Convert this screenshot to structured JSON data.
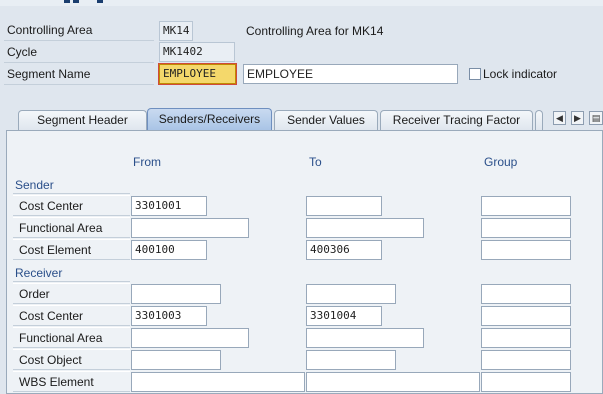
{
  "header": {
    "controlling_area": {
      "label": "Controlling Area",
      "value": "MK14",
      "description": "Controlling Area for MK14"
    },
    "cycle": {
      "label": "Cycle",
      "value": "MK1402"
    },
    "segment_name": {
      "label": "Segment Name",
      "value": "EMPLOYEE",
      "description": "EMPLOYEE"
    },
    "lock_indicator": {
      "label": "Lock indicator",
      "checked": false
    }
  },
  "tabs": [
    {
      "label": "Segment Header",
      "active": false
    },
    {
      "label": "Senders/Receivers",
      "active": true
    },
    {
      "label": "Sender Values",
      "active": false
    },
    {
      "label": "Receiver Tracing Factor",
      "active": false
    }
  ],
  "tab_nav": {
    "prev_icon": "arrow-left-icon",
    "next_icon": "arrow-right-icon",
    "list_icon": "tab-list-icon"
  },
  "columns": {
    "from": "From",
    "to": "To",
    "group": "Group"
  },
  "sender": {
    "title": "Sender",
    "rows": [
      {
        "label": "Cost Center",
        "from": "3301001",
        "to": "",
        "group": ""
      },
      {
        "label": "Functional Area",
        "from": "",
        "to": "",
        "group": ""
      },
      {
        "label": "Cost Element",
        "from": "400100",
        "to": "400306",
        "group": ""
      }
    ]
  },
  "receiver": {
    "title": "Receiver",
    "rows": [
      {
        "label": "Order",
        "from": "",
        "to": "",
        "group": ""
      },
      {
        "label": "Cost Center",
        "from": "3301003",
        "to": "3301004",
        "group": ""
      },
      {
        "label": "Functional Area",
        "from": "",
        "to": "",
        "group": ""
      },
      {
        "label": "Cost Object",
        "from": "",
        "to": "",
        "group": ""
      },
      {
        "label": "WBS Element",
        "from": "",
        "to": "",
        "group": ""
      }
    ]
  },
  "colors": {
    "accent": "#2a4f8a",
    "active_tab": "#a9c4e6",
    "selected_field": "#f4d86b",
    "background": "#dfe6ee"
  }
}
